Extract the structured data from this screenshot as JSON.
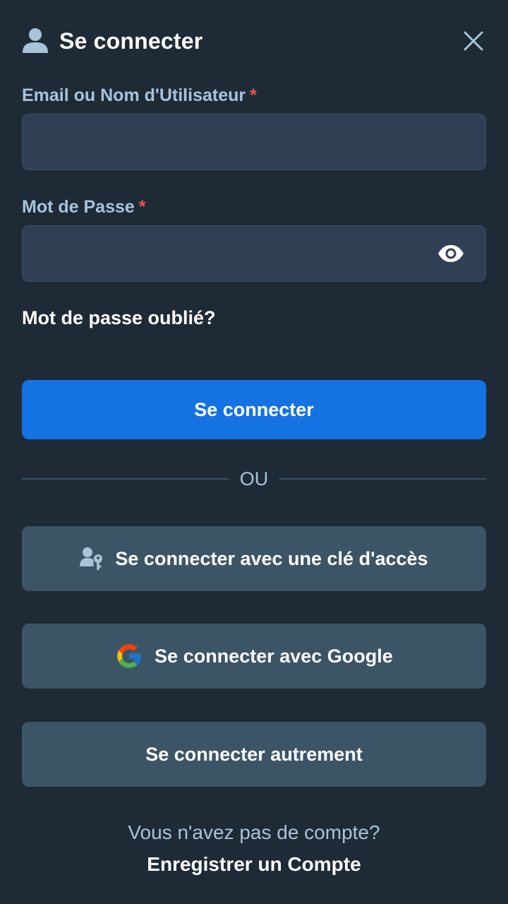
{
  "header": {
    "title": "Se connecter",
    "user_icon": "user-icon",
    "close_icon": "close-icon"
  },
  "form": {
    "email_label": "Email ou Nom d'Utilisateur",
    "email_required": "*",
    "email_value": "",
    "email_placeholder": "",
    "password_label": "Mot de Passe",
    "password_required": "*",
    "password_value": "",
    "password_placeholder": "",
    "show_password_icon": "eye-icon",
    "forgot_password": "Mot de passe oublié?",
    "submit_label": "Se connecter"
  },
  "divider": {
    "label": "OU"
  },
  "alternatives": {
    "passkey_label": "Se connecter avec une clé d'accès",
    "passkey_icon": "passkey-icon",
    "google_label": "Se connecter avec Google",
    "google_icon": "google-icon",
    "other_label": "Se connecter autrement"
  },
  "footer": {
    "question": "Vous n'avez pas de compte?",
    "register_link": "Enregistrer un Compte"
  },
  "colors": {
    "background": "#1e2b37",
    "input_bg": "#2f4055",
    "primary": "#1472e3",
    "secondary_btn": "#3c5566",
    "label": "#a9c3d9",
    "required": "#ef5350"
  }
}
